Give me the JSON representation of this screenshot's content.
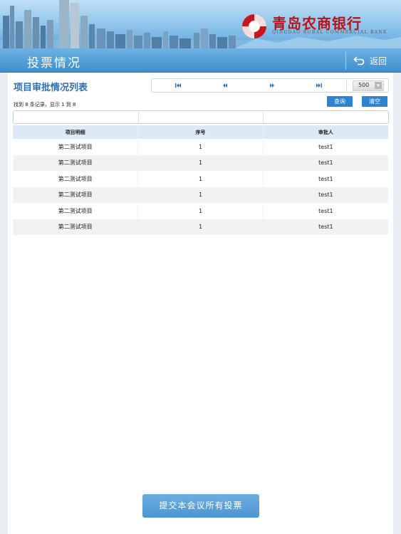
{
  "brand": {
    "name": "青岛农商银行",
    "name_en": "QINGDAO RURAL COMMERCIAL BANK",
    "color": "#b8141b"
  },
  "header": {
    "title": "投票情况",
    "back_label": "返回",
    "back_icon": "return-arrow-icon"
  },
  "list": {
    "title": "项目审批情况列表",
    "pager": {
      "icons": [
        "first-page-icon",
        "prev-page-icon",
        "next-page-icon",
        "last-page-icon"
      ],
      "page_size": "500"
    },
    "records_text": "找到 8 条记录，显示 1 到 8",
    "query_label": "查询",
    "clear_label": "清空",
    "columns": [
      "项目明细",
      "序号",
      "审批人"
    ],
    "rows": [
      [
        "第二测试项目",
        "1",
        "test1"
      ],
      [
        "第二测试项目",
        "1",
        "test1"
      ],
      [
        "第二测试项目",
        "1",
        "test1"
      ],
      [
        "第二测试项目",
        "1",
        "test1"
      ],
      [
        "第二测试项目",
        "1",
        "test1"
      ],
      [
        "第二测试项目",
        "1",
        "test1"
      ]
    ]
  },
  "footer": {
    "submit_label": "提交本会议所有投票"
  },
  "colors": {
    "accent": "#2e83d1",
    "title_bar": "#3d8ecd",
    "list_title": "#2d6fb8"
  }
}
